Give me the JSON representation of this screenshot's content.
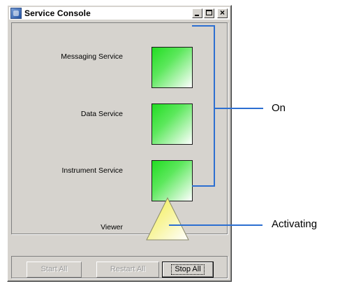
{
  "window": {
    "title": "Service Console",
    "controls": {
      "minimize": "_",
      "maximize": "□",
      "close": "×"
    }
  },
  "services": [
    {
      "label": "Messaging Service",
      "status_shape": "square",
      "status_color": "#22dd22"
    },
    {
      "label": "Data Service",
      "status_shape": "square",
      "status_color": "#22dd22"
    },
    {
      "label": "Instrument Service",
      "status_shape": "square",
      "status_color": "#22dd22"
    },
    {
      "label": "Viewer",
      "status_shape": "triangle",
      "status_color": "#f4ef6a"
    }
  ],
  "buttons": {
    "start_all": "Start All",
    "restart_all": "Restart All",
    "stop_all": "Stop All"
  },
  "callouts": {
    "on": "On",
    "activating": "Activating",
    "line_color": "#2c6fd1"
  }
}
